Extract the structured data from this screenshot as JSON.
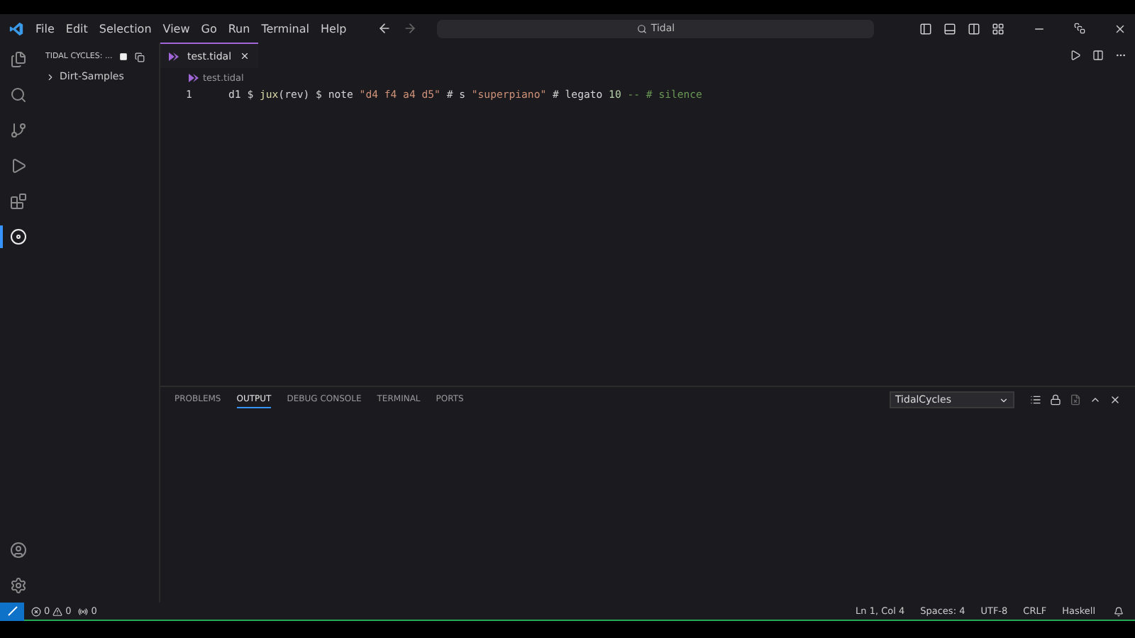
{
  "menu": [
    "File",
    "Edit",
    "Selection",
    "View",
    "Go",
    "Run",
    "Terminal",
    "Help"
  ],
  "search": {
    "value": "Tidal"
  },
  "activity": [
    {
      "selected": false
    },
    {
      "selected": false
    },
    {
      "selected": false
    },
    {
      "selected": false
    },
    {
      "selected": false
    },
    {
      "selected": true
    }
  ],
  "sidebar": {
    "title": "TIDAL CYCLES: ...",
    "items": [
      {
        "label": "Dirt-Samples",
        "expanded": false
      }
    ]
  },
  "editor": {
    "tab": "test.tidal",
    "breadcrumb": "test.tidal",
    "lines": [
      {
        "number": "1",
        "tokens": [
          {
            "kind": "plain",
            "text": "d1 "
          },
          {
            "kind": "plain",
            "text": "$ "
          },
          {
            "kind": "func",
            "text": "jux"
          },
          {
            "kind": "plain",
            "text": "(rev) $ note "
          },
          {
            "kind": "string",
            "text": "\"d4 f4 a4 d5\""
          },
          {
            "kind": "plain",
            "text": " # s "
          },
          {
            "kind": "string",
            "text": "\"superpiano\""
          },
          {
            "kind": "plain",
            "text": " # legato "
          },
          {
            "kind": "number",
            "text": "10"
          },
          {
            "kind": "comment",
            "text": " -- # silence"
          }
        ]
      }
    ]
  },
  "panel": {
    "tabs": [
      {
        "label": "PROBLEMS",
        "selected": false
      },
      {
        "label": "OUTPUT",
        "selected": true
      },
      {
        "label": "DEBUG CONSOLE",
        "selected": false
      },
      {
        "label": "TERMINAL",
        "selected": false
      },
      {
        "label": "PORTS",
        "selected": false
      }
    ],
    "channel": "TidalCycles"
  },
  "status": {
    "errors": "0",
    "warnings": "0",
    "ports": "0",
    "right": [
      "Ln 1, Col 4",
      "Spaces: 4",
      "UTF-8",
      "CRLF",
      "Haskell"
    ]
  }
}
